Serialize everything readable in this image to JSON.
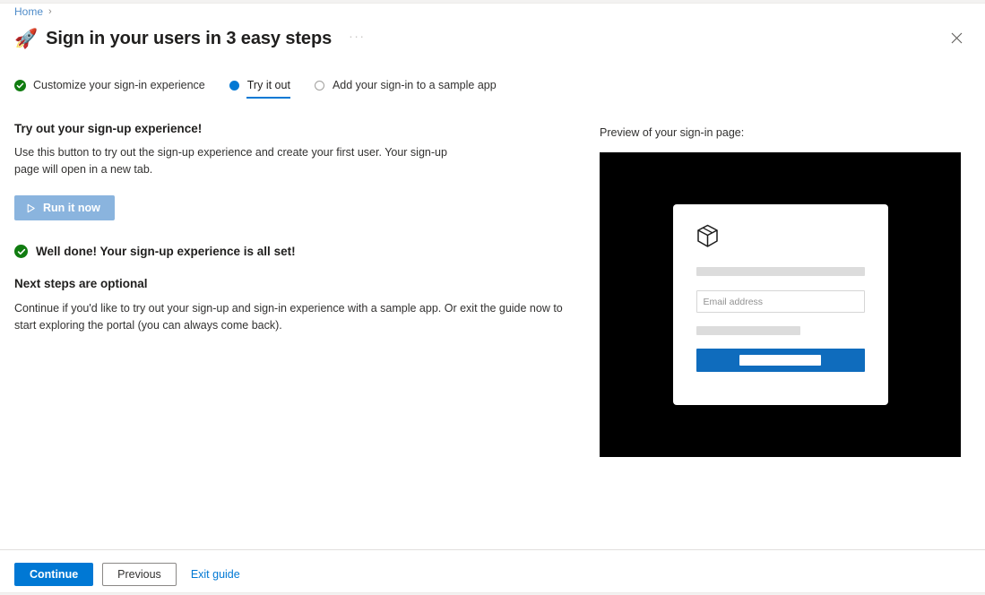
{
  "breadcrumb": {
    "home_label": "Home",
    "chevron": "›"
  },
  "header": {
    "rocket_icon": "🚀",
    "title": "Sign in your users in 3 easy steps",
    "ellipsis": "···",
    "close_icon": "close-icon"
  },
  "steps": [
    {
      "label": "Customize your sign-in experience",
      "state": "done"
    },
    {
      "label": "Try it out",
      "state": "current"
    },
    {
      "label": "Add your sign-in to a sample app",
      "state": "todo"
    }
  ],
  "main": {
    "heading": "Try out your sign-up experience!",
    "description": "Use this button to try out the sign-up experience and create your first user. Your sign-up page will open in a new tab.",
    "run_button_label": "Run it now",
    "well_done_text": "Well done! Your sign-up experience is all set!",
    "next_heading": "Next steps are optional",
    "next_body": "Continue if you'd like to try out your sign-up and sign-in experience with a sample app. Or exit the guide now to start exploring the portal (you can always come back)."
  },
  "preview": {
    "label": "Preview of your sign-in page:",
    "logo_icon": "cube-box-icon",
    "email_placeholder": "Email address"
  },
  "footer": {
    "continue_label": "Continue",
    "previous_label": "Previous",
    "exit_label": "Exit guide"
  },
  "colors": {
    "accent": "#0078d4",
    "success": "#107c10",
    "run_button_disabled": "#8ab4de",
    "preview_submit": "#0f6cbd",
    "link": "#4f8cc9"
  }
}
